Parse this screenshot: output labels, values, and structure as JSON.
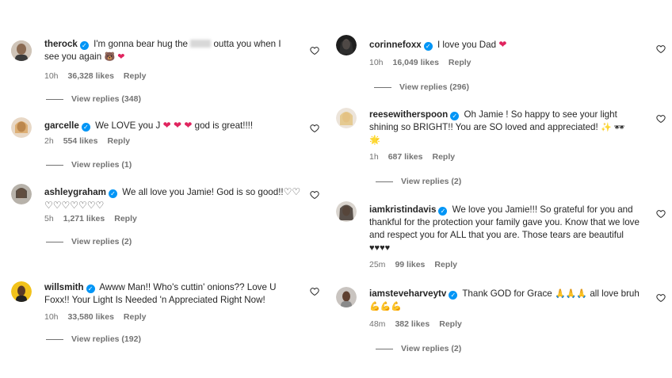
{
  "left": [
    {
      "username": "therock",
      "text_before": "I'm gonna bear hug the",
      "text_after": "outta you when I see you again",
      "emojis": "🐻 ❤",
      "time": "10h",
      "likes": "36,328 likes",
      "reply": "Reply",
      "view_replies": "View replies (348)"
    },
    {
      "username": "garcelle",
      "text": "We LOVE you J",
      "hearts": "❤ ❤ ❤",
      "text_after": "god is great!!!!",
      "time": "2h",
      "likes": "554 likes",
      "reply": "Reply",
      "view_replies": "View replies (1)"
    },
    {
      "username": "ashleygraham",
      "text": "We all love you Jamie! God is so good!!",
      "hearts_line1": "♡♡",
      "hearts_line2": "♡♡♡♡♡♡♡",
      "time": "5h",
      "likes": "1,271 likes",
      "reply": "Reply",
      "view_replies": "View replies (2)"
    },
    {
      "username": "willsmith",
      "text": "Awww Man!! Who's cuttin' onions?? Love U Foxx!! Your Light Is Needed 'n Appreciated Right Now!",
      "time": "10h",
      "likes": "33,580 likes",
      "reply": "Reply",
      "view_replies": "View replies (192)"
    }
  ],
  "right": [
    {
      "username": "corinnefoxx",
      "text": "I love you Dad",
      "emojis": "❤",
      "time": "10h",
      "likes": "16,049 likes",
      "reply": "Reply",
      "view_replies": "View replies (296)"
    },
    {
      "username": "reesewitherspoon",
      "text": "Oh Jamie ! So happy to see your light shining so BRIGHT!! You are SO loved and appreciated!",
      "emojis": "✨ 🕶",
      "emojis_line2": "🌟",
      "time": "1h",
      "likes": "687 likes",
      "reply": "Reply",
      "view_replies": "View replies (2)"
    },
    {
      "username": "iamkristindavis",
      "text": "We love you Jamie!!! So grateful for you and thankful for the protection your family gave you. Know that we love and respect you for ALL that you are. Those tears are beautiful",
      "emojis": "♥♥♥♥",
      "time": "25m",
      "likes": "99 likes",
      "reply": "Reply"
    },
    {
      "username": "iamsteveharveytv",
      "text": "Thank GOD for Grace",
      "emojis": "🙏🙏🙏",
      "text_after": "all love bruh",
      "emojis_after": "💪💪💪",
      "time": "48m",
      "likes": "382 likes",
      "reply": "Reply",
      "view_replies": "View replies (2)"
    }
  ],
  "icons": {
    "verified": "verified-badge-icon",
    "like": "heart-outline-icon"
  },
  "colors": {
    "verified": "#0095f6",
    "heart": "#e0245e",
    "meta": "#737373"
  }
}
